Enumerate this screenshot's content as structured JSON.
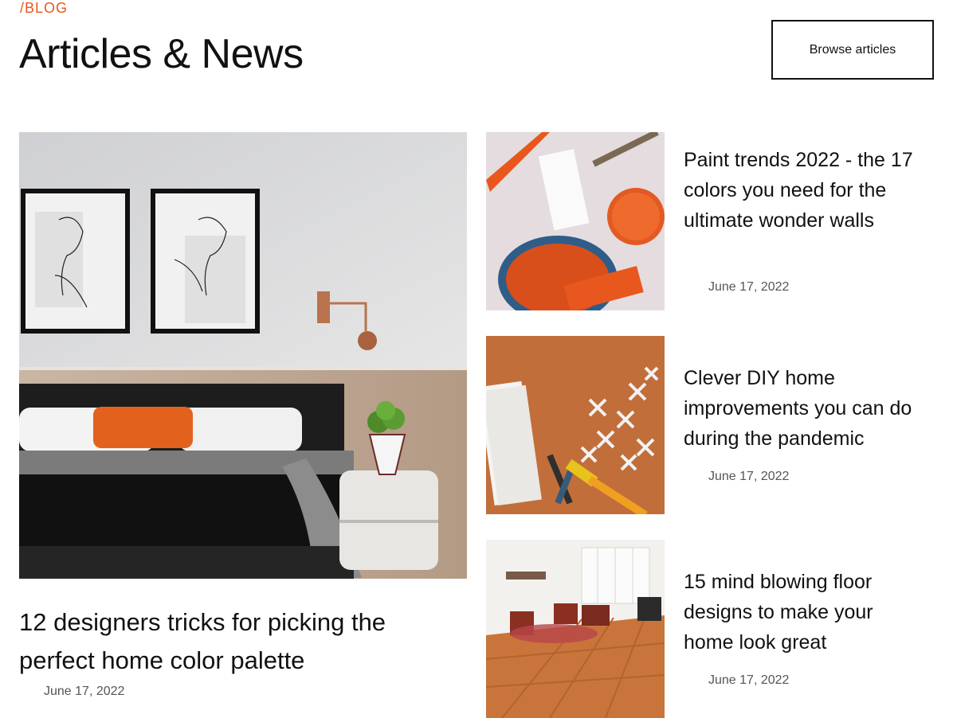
{
  "header": {
    "eyebrow": "/BLOG",
    "title": "Articles & News",
    "browse_label": "Browse articles"
  },
  "featured": {
    "title": "12 designers tricks for picking the perfect home color palette",
    "date": "June 17, 2022",
    "image": "bedroom-interior-image"
  },
  "articles": [
    {
      "title": "Paint trends 2022 - the 17 colors you need for the ultimate wonder walls",
      "date": "June 17, 2022",
      "image": "paint-cans-image"
    },
    {
      "title": "Clever DIY home improvements you can do during the pandemic",
      "date": "June 17, 2022",
      "image": "tile-spacers-image"
    },
    {
      "title": "15 mind blowing floor designs to make your home look great",
      "date": "June 17, 2022",
      "image": "wood-floor-room-image"
    }
  ],
  "colors": {
    "accent": "#e8571d",
    "text": "#111111",
    "muted": "#555555"
  }
}
